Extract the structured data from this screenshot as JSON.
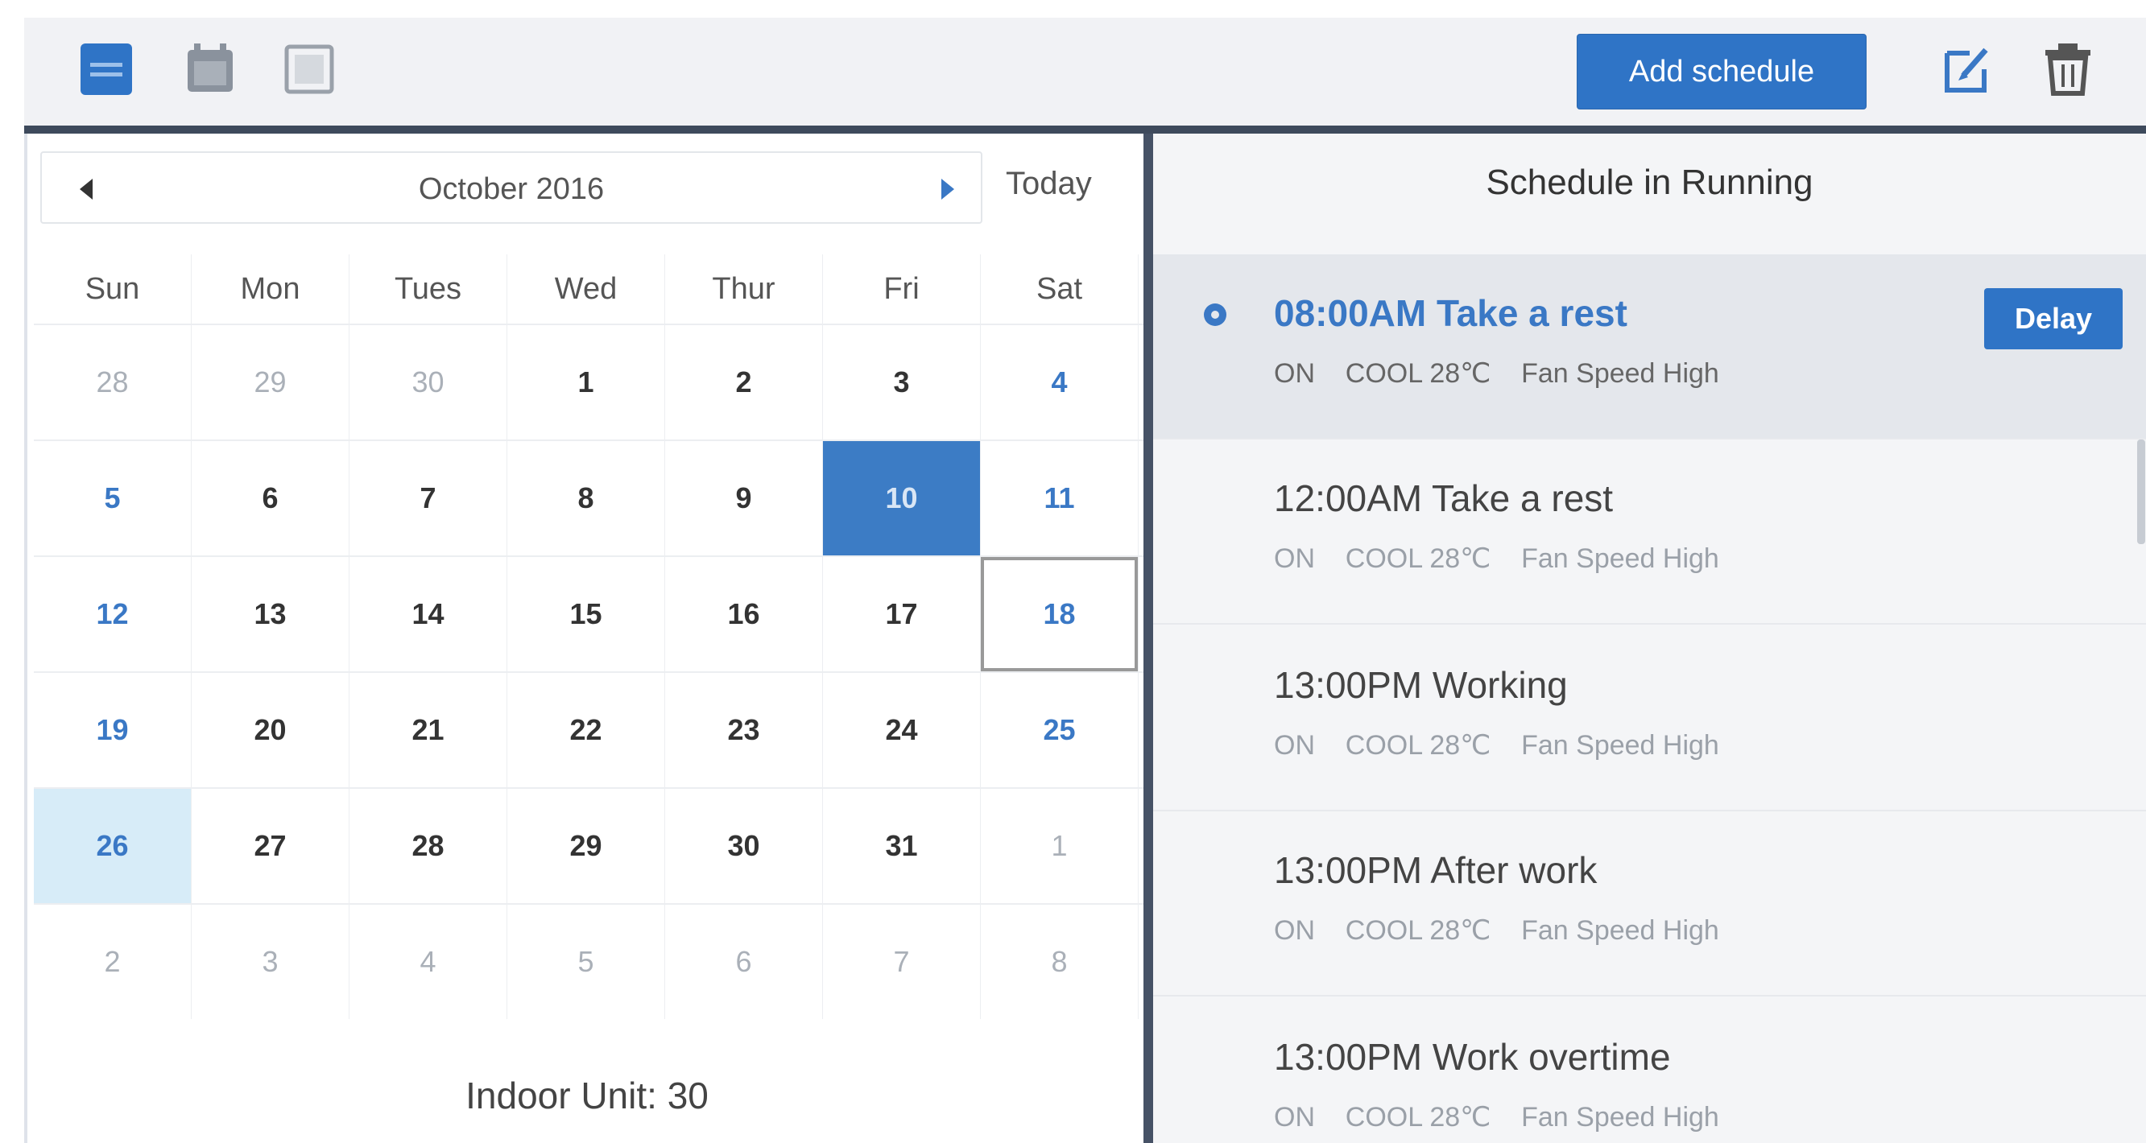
{
  "toolbar": {
    "add_schedule_label": "Add schedule",
    "icons": [
      "list-view-icon",
      "calendar-view-icon",
      "grid-view-icon",
      "edit-icon",
      "trash-icon"
    ],
    "accent": "#2f74c6"
  },
  "calendar": {
    "month_title": "October 2016",
    "today_label": "Today",
    "weekdays": [
      "Sun",
      "Mon",
      "Tues",
      "Wed",
      "Thur",
      "Fri",
      "Sat"
    ],
    "weeks": [
      [
        "28",
        "29",
        "30",
        "1",
        "2",
        "3",
        "4"
      ],
      [
        "5",
        "6",
        "7",
        "8",
        "9",
        "10",
        "11"
      ],
      [
        "12",
        "13",
        "14",
        "15",
        "16",
        "17",
        "18"
      ],
      [
        "19",
        "20",
        "21",
        "22",
        "23",
        "24",
        "25"
      ],
      [
        "26",
        "27",
        "28",
        "29",
        "30",
        "31",
        "1"
      ],
      [
        "2",
        "3",
        "4",
        "5",
        "6",
        "7",
        "8"
      ]
    ],
    "selected_day": "10",
    "today_day": "26",
    "outlined_day": "18"
  },
  "unit_label": "Indoor Unit: 30",
  "schedule_panel": {
    "title": "Schedule in Running",
    "delay_label": "Delay",
    "items": [
      {
        "title": "08:00AM Take a rest",
        "detail": "ON    COOL 28℃    Fan Speed High",
        "active": true
      },
      {
        "title": "12:00AM Take a rest",
        "detail": "ON    COOL 28℃    Fan Speed High",
        "active": false
      },
      {
        "title": "13:00PM Working",
        "detail": "ON    COOL 28℃    Fan Speed High",
        "active": false
      },
      {
        "title": "13:00PM After work",
        "detail": "ON    COOL 28℃    Fan Speed High",
        "active": false
      },
      {
        "title": "13:00PM Work overtime",
        "detail": "ON    COOL 28℃    Fan Speed High",
        "active": false
      }
    ]
  }
}
